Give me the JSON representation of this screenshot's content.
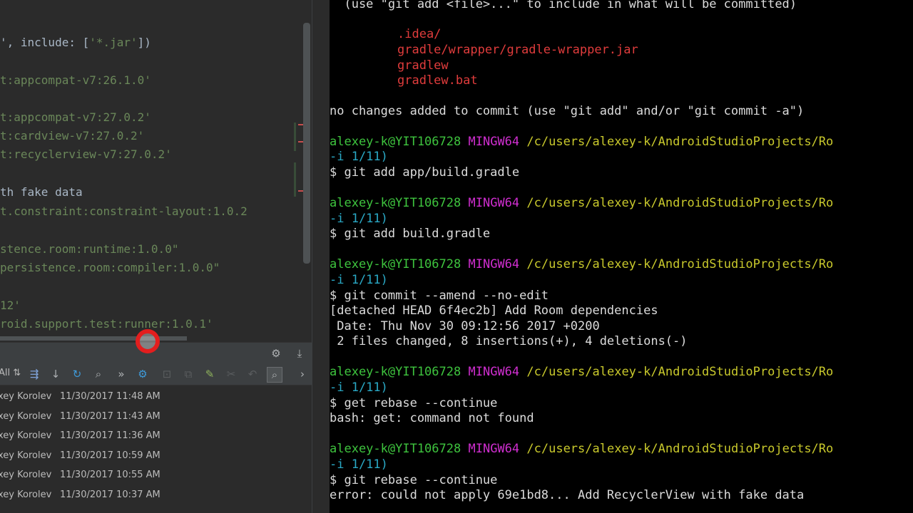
{
  "editor": {
    "lines": [
      {
        "plain": "', include: [",
        "str": "'*.jar'",
        "tail": "])"
      },
      {
        "plain": "",
        "str": "t:appcompat-v7:26.1.0'",
        "tail": ""
      },
      {
        "plain": "",
        "str": "t:appcompat-v7:27.0.2'",
        "tail": ""
      },
      {
        "plain": "",
        "str": "t:cardview-v7:27.0.2'",
        "tail": ""
      },
      {
        "plain": "",
        "str": "t:recyclerview-v7:27.0.2'",
        "tail": ""
      },
      {
        "plain": "th fake data",
        "str": "",
        "tail": ""
      },
      {
        "plain": "",
        "str": "t.constraint:constraint-layout:1.0.2",
        "tail": ""
      },
      {
        "plain": "",
        "str": "stence.room:runtime:1.0.0\"",
        "tail": ""
      },
      {
        "plain": "",
        "str": "persistence.room:compiler:1.0.0\"",
        "tail": ""
      },
      {
        "plain": "",
        "str": "12'",
        "tail": ""
      },
      {
        "plain": "",
        "str": "roid.support.test:runner:1.0.1'",
        "tail": ""
      }
    ]
  },
  "vcs": {
    "filter_label": "All",
    "icons": [
      "expand-icon",
      "down-arrow-icon",
      "refresh-icon",
      "search-icon",
      "more-icon",
      "settings-icon",
      "cherry-pick-icon",
      "copy-icon",
      "edit-icon",
      "tools-icon",
      "undo-icon",
      "find-icon",
      "expand-right-icon"
    ],
    "log": [
      {
        "author": "xey Korolev",
        "date": "11/30/2017 11:48 AM"
      },
      {
        "author": "xey Korolev",
        "date": "11/30/2017 11:43 AM"
      },
      {
        "author": "xey Korolev",
        "date": "11/30/2017 11:36 AM"
      },
      {
        "author": "xey Korolev",
        "date": "11/30/2017 10:59 AM"
      },
      {
        "author": "xey Korolev",
        "date": "11/30/2017 10:55 AM"
      },
      {
        "author": "xey Korolev",
        "date": "11/30/2017 10:37 AM"
      }
    ]
  },
  "terminal": {
    "hint": "  (use \"git add <file>...\" to include in what will be committed)",
    "untracked": [
      ".idea/",
      "gradle/wrapper/gradle-wrapper.jar",
      "gradlew",
      "gradlew.bat"
    ],
    "no_changes": "no changes added to commit (use \"git add\" and/or \"git commit -a\")",
    "prompt_user": "alexey-k@YIT106728",
    "prompt_host": "MINGW64",
    "prompt_path": "/c/users/alexey-k/AndroidStudioProjects/Ro",
    "prompt_status": "-i 1/11)",
    "cmd1": "$ git add app/build.gradle",
    "cmd2": "$ git add build.gradle",
    "cmd3": "$ git commit --amend --no-edit",
    "commit_out1": "[detached HEAD 6f4ec2b] Add Room dependencies",
    "commit_out2": " Date: Thu Nov 30 09:12:56 2017 +0200",
    "commit_out3": " 2 files changed, 8 insertions(+), 4 deletions(-)",
    "cmd4": "$ get rebase --continue",
    "err4": "bash: get: command not found",
    "cmd5": "$ git rebase --continue",
    "err5": "error: could not apply 69e1bd8... Add RecyclerView with fake data"
  }
}
